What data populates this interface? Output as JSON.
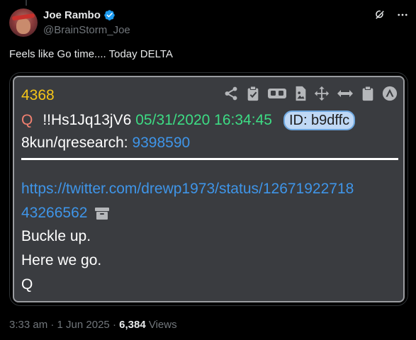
{
  "author": {
    "name": "Joe Rambo",
    "handle": "@BrainStorm_Joe"
  },
  "tweet": {
    "text": "Feels like Go time.... Today DELTA"
  },
  "qpost": {
    "number": "4368",
    "q_label": "Q",
    "tripcode": "!!Hs1Jq13jV6",
    "datetime": "05/31/2020 16:34:45",
    "id_badge": "ID: b9dffc",
    "board_label": "8kun/qresearch:",
    "board_link": "9398590",
    "url_line1": "https://twitter.com/drewp1973/status/12671922718",
    "url_line2": "43266562",
    "lines": [
      "Buckle up.",
      "Here we go.",
      "Q"
    ]
  },
  "meta": {
    "time": "3:33 am",
    "sep1": "·",
    "date": "1 Jun 2025",
    "sep2": "·",
    "views_count": "6,384",
    "views_label": "Views"
  },
  "colors": {
    "background": "#000000",
    "panel": "#3a3c40",
    "q_number": "#f5c518",
    "date": "#3ddc84",
    "link": "#3f95e8",
    "verified": "#1d9bf0"
  },
  "icons": [
    "grok-icon",
    "more-icon",
    "share-icon",
    "clipboard-check-icon",
    "vr-goggles-icon",
    "image-file-icon",
    "move-arrows-icon",
    "horizontal-arrows-icon",
    "clipboard-icon",
    "triangle-circle-icon",
    "archive-icon"
  ]
}
